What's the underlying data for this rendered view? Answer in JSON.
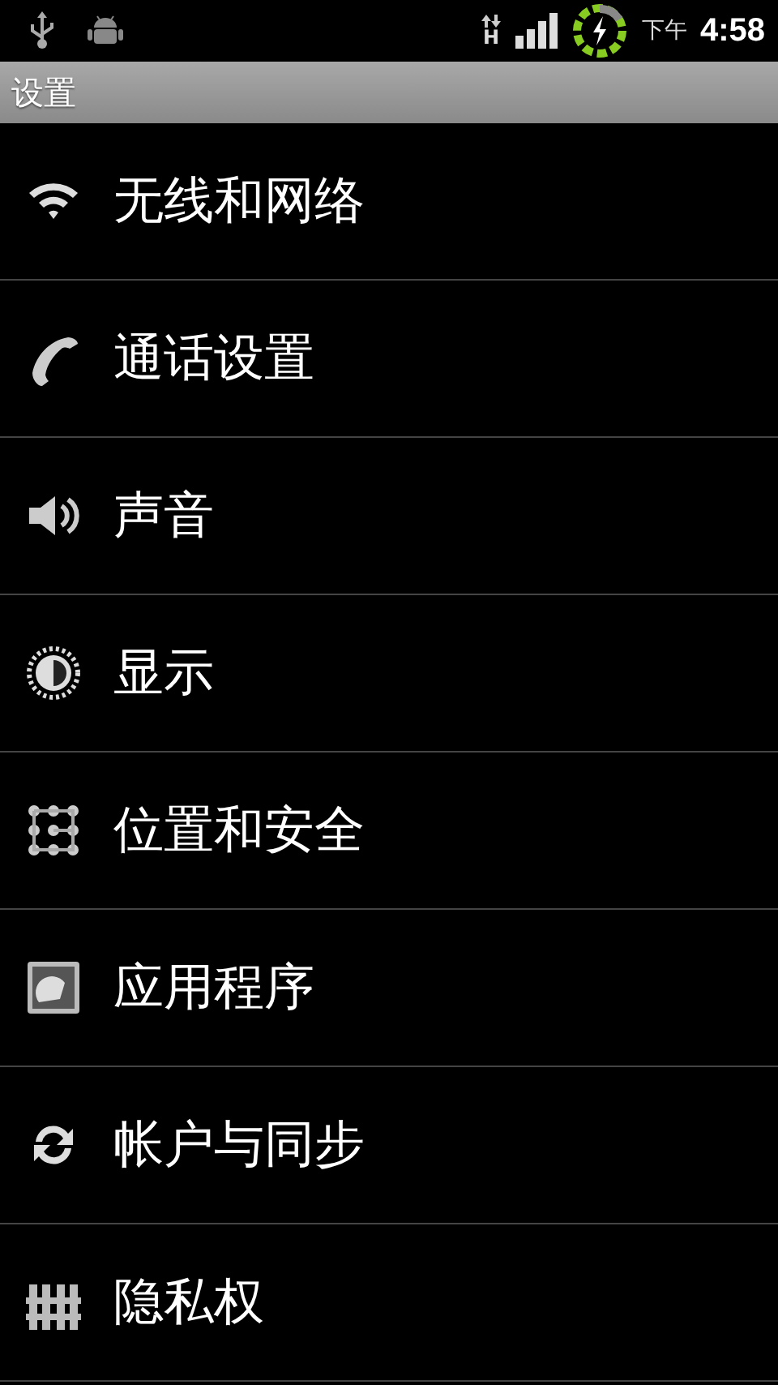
{
  "status_bar": {
    "period": "下午",
    "time": "4:58",
    "data_type": "H"
  },
  "title_bar": {
    "title": "设置"
  },
  "settings": [
    {
      "label": "无线和网络"
    },
    {
      "label": "通话设置"
    },
    {
      "label": "声音"
    },
    {
      "label": "显示"
    },
    {
      "label": "位置和安全"
    },
    {
      "label": "应用程序"
    },
    {
      "label": "帐户与同步"
    },
    {
      "label": "隐私权"
    }
  ]
}
